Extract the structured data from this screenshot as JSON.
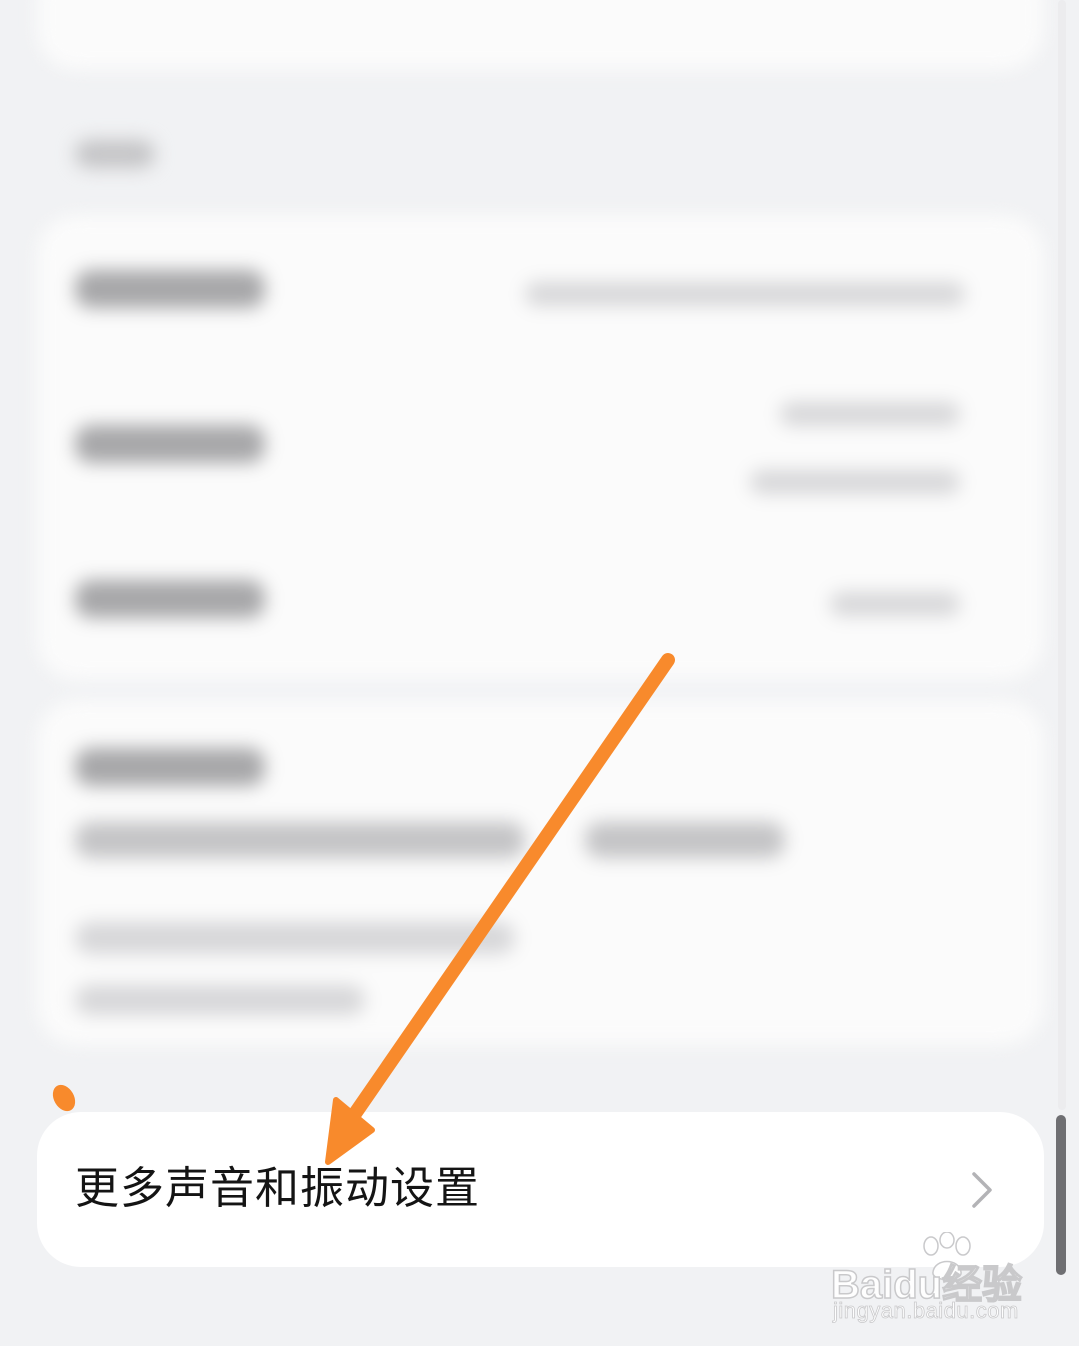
{
  "settings": {
    "more_sound_vibration_label": "更多声音和振动设置"
  },
  "icons": {
    "chevron": "chevron-right-icon",
    "arrow": "annotation-arrow-icon"
  },
  "colors": {
    "annotation_arrow": "#f88a2c",
    "card_background": "#ffffff",
    "page_background": "#f1f2f4"
  },
  "watermark": {
    "brand": "Baidu经验",
    "url": "jingyan.baidu.com"
  }
}
